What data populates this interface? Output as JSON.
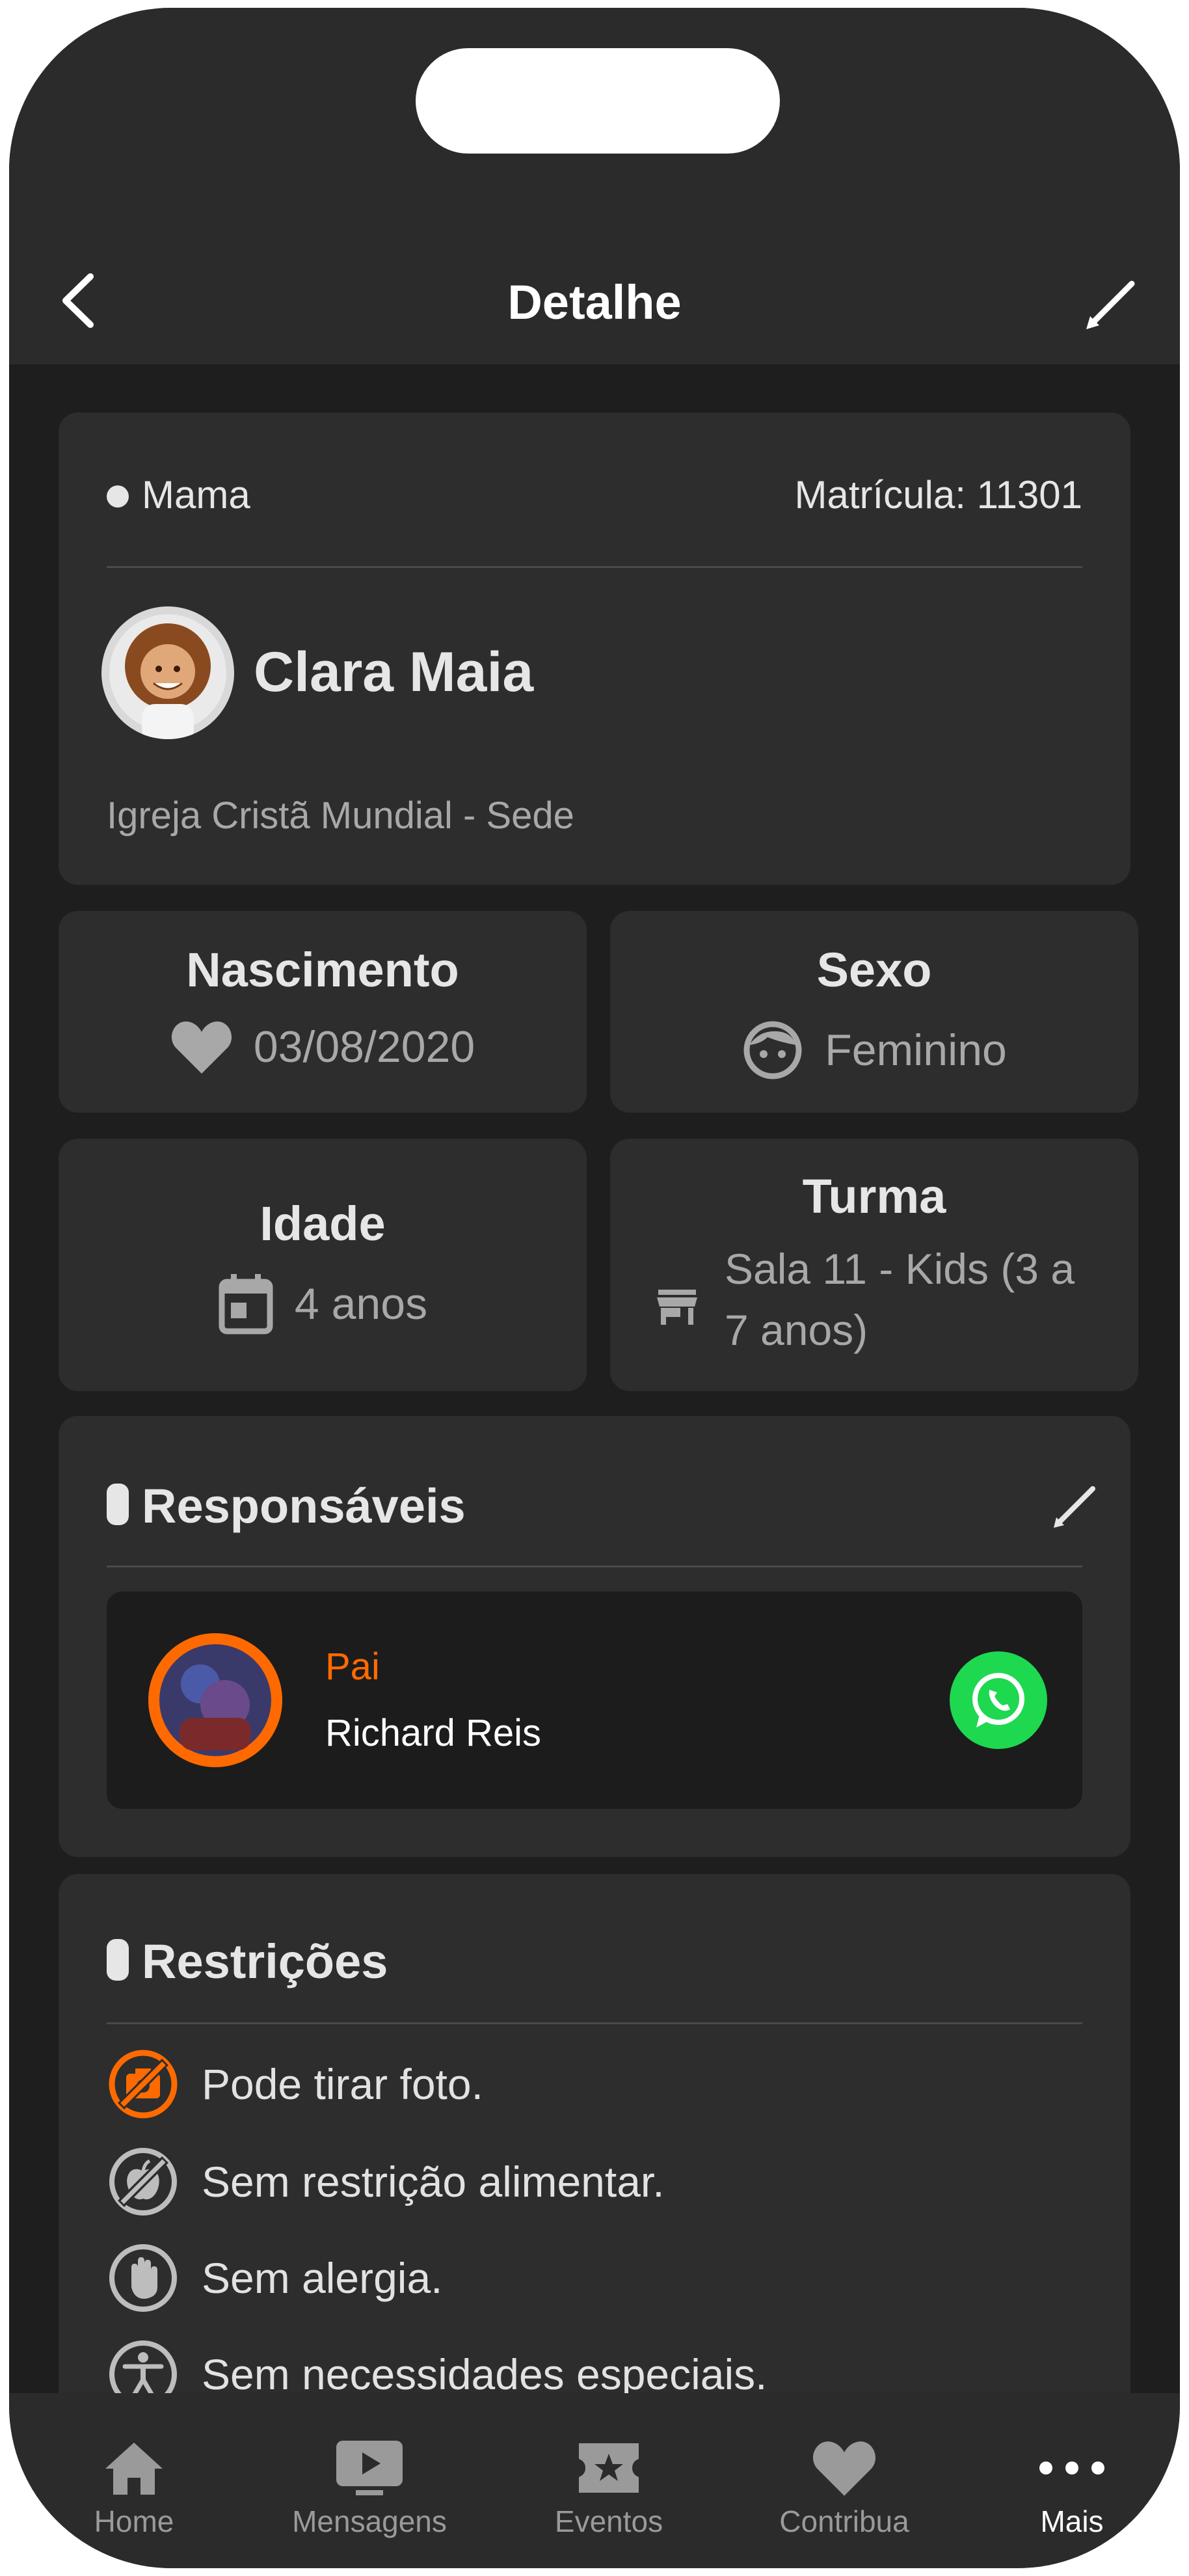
{
  "header": {
    "title": "Detalhe",
    "back_icon": "chevron-left-icon",
    "edit_icon": "pencil-icon"
  },
  "profile": {
    "status": "Mama",
    "registration": "Matrícula: 11301",
    "name": "Clara Maia",
    "church": "Igreja Cristã Mundial - Sede"
  },
  "info": {
    "birth": {
      "label": "Nascimento",
      "value": "03/08/2020",
      "icon": "heart-icon"
    },
    "sex": {
      "label": "Sexo",
      "value": "Feminino",
      "icon": "face-icon"
    },
    "age": {
      "label": "Idade",
      "value": "4 anos",
      "icon": "calendar-icon"
    },
    "class": {
      "label": "Turma",
      "value_line1": "Sala 11 - Kids (3 a",
      "value_line2": "7 anos)",
      "icon": "store-icon"
    }
  },
  "responsibles": {
    "title": "Responsáveis",
    "items": [
      {
        "relation": "Pai",
        "name": "Richard Reis",
        "action_icon": "whatsapp-icon"
      }
    ]
  },
  "restrictions": {
    "title": "Restrições",
    "items": [
      {
        "text": "Pode tirar foto.",
        "icon": "no-camera-icon"
      },
      {
        "text": "Sem restrição alimentar.",
        "icon": "no-food-icon"
      },
      {
        "text": "Sem alergia.",
        "icon": "hand-icon"
      },
      {
        "text": "Sem necessidades especiais.",
        "icon": "accessibility-icon"
      }
    ]
  },
  "nav": {
    "items": [
      {
        "label": "Home",
        "icon": "home-icon"
      },
      {
        "label": "Mensagens",
        "icon": "video-icon"
      },
      {
        "label": "Eventos",
        "icon": "ticket-icon"
      },
      {
        "label": "Contribua",
        "icon": "heart-icon"
      },
      {
        "label": "Mais",
        "icon": "more-icon"
      }
    ],
    "active": "Mais"
  },
  "colors": {
    "accent": "#ff6a00",
    "whatsapp": "#1ed84f",
    "background": "#1e1e1e",
    "card": "#2d2d2d"
  }
}
